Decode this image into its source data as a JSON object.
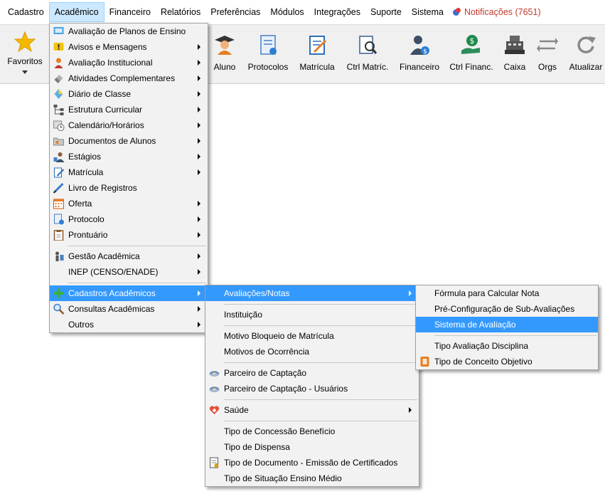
{
  "menubar": {
    "items": [
      {
        "label": "Cadastro"
      },
      {
        "label": "Acadêmico"
      },
      {
        "label": "Financeiro"
      },
      {
        "label": "Relatórios"
      },
      {
        "label": "Preferências"
      },
      {
        "label": "Módulos"
      },
      {
        "label": "Integrações"
      },
      {
        "label": "Suporte"
      },
      {
        "label": "Sistema"
      }
    ],
    "notifications": "Notificações (7651)"
  },
  "toolbar": {
    "favoritos": "Favoritos",
    "buttons": [
      {
        "label": "Aluno",
        "icon": "student-icon"
      },
      {
        "label": "Protocolos",
        "icon": "protocol-icon"
      },
      {
        "label": "Matrícula",
        "icon": "enrollment-icon"
      },
      {
        "label": "Ctrl Matríc.",
        "icon": "enrollment-control-icon"
      },
      {
        "label": "Financeiro",
        "icon": "finance-icon"
      },
      {
        "label": "Ctrl Financ.",
        "icon": "finance-control-icon"
      },
      {
        "label": "Caixa",
        "icon": "cash-register-icon"
      },
      {
        "label": "Orgs",
        "icon": "orgs-icon"
      },
      {
        "label": "Atualizar",
        "icon": "refresh-icon"
      }
    ]
  },
  "menu_academico": {
    "items": [
      "Avaliação de Planos de Ensino",
      "Avisos e Mensagens",
      "Avaliação Institucional",
      "Atividades Complementares",
      "Diário de Classe",
      "Estrutura Curricular",
      "Calendário/Horários",
      "Documentos de Alunos",
      "Estágios",
      "Matrícula",
      "Livro de Registros",
      "Oferta",
      "Protocolo",
      "Prontuário",
      "Gestão Acadêmica",
      "INEP (CENSO/ENADE)",
      "Cadastros Acadêmicos",
      "Consultas Acadêmicas",
      "Outros"
    ]
  },
  "menu_cadastros": {
    "items": [
      "Avaliações/Notas",
      "Instituição",
      "Motivo Bloqueio de Matrícula",
      "Motivos de Ocorrência",
      "Parceiro de Captação",
      "Parceiro de Captação - Usuários",
      "Saúde",
      "Tipo de Concessão Benefício",
      "Tipo de Dispensa",
      "Tipo de Documento - Emissão de Certificados",
      "Tipo de Situação Ensino Médio"
    ]
  },
  "menu_avaliacoes": {
    "items": [
      "Fórmula para Calcular Nota",
      "Pré-Configuração de Sub-Avaliações",
      "Sistema de Avaliação",
      "Tipo Avaliação Disciplina",
      "Tipo de Conceito Objetivo"
    ]
  },
  "colors": {
    "highlight": "#3399ff",
    "menu_bg": "#f2f2f2",
    "active_menu": "#cce8ff",
    "notification": "#c0392b"
  }
}
